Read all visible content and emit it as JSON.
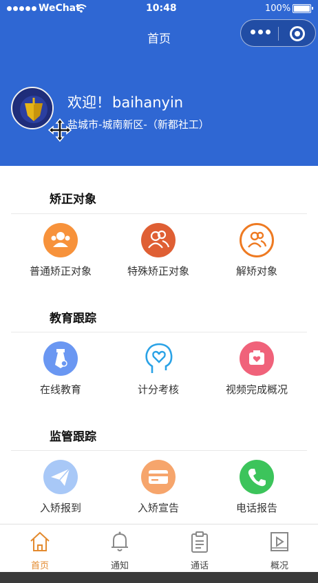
{
  "status_bar": {
    "carrier": "WeChat",
    "time": "10:48",
    "battery": "100%"
  },
  "nav": {
    "title": "首页"
  },
  "user": {
    "welcome_prefix": "欢迎！",
    "username": "baihanyin",
    "location": "盐城市-城南新区-（新都社工）"
  },
  "sections": [
    {
      "title": "矫正对象",
      "items": [
        {
          "label": "普通矫正对象",
          "icon": "group-people-icon",
          "color": "#f7923b"
        },
        {
          "label": "特殊矫正对象",
          "icon": "two-people-icon",
          "color": "#df5f34"
        },
        {
          "label": "解矫对象",
          "icon": "people-outline-icon",
          "color": "#ee7a22"
        }
      ]
    },
    {
      "title": "教育跟踪",
      "items": [
        {
          "label": "在线教育",
          "icon": "tie-icon",
          "color": "#6a97f2"
        },
        {
          "label": "计分考核",
          "icon": "head-heart-icon",
          "color": "#2aa2e6"
        },
        {
          "label": "视频完成概况",
          "icon": "camera-heart-icon",
          "color": "#f0627a"
        }
      ]
    },
    {
      "title": "监管跟踪",
      "items": [
        {
          "label": "入矫报到",
          "icon": "paper-plane-icon",
          "color": "#a8c8f7"
        },
        {
          "label": "入矫宣告",
          "icon": "card-icon",
          "color": "#f6a56c"
        },
        {
          "label": "电话报告",
          "icon": "phone-icon",
          "color": "#3cc45b"
        }
      ]
    }
  ],
  "tabbar": [
    {
      "label": "首页",
      "icon": "home-icon",
      "active": true
    },
    {
      "label": "通知",
      "icon": "bell-icon",
      "active": false
    },
    {
      "label": "通话",
      "icon": "clipboard-icon",
      "active": false
    },
    {
      "label": "概况",
      "icon": "play-document-icon",
      "active": false
    }
  ],
  "colors": {
    "header": "#2f67d3",
    "tab_active": "#e38a2e"
  }
}
